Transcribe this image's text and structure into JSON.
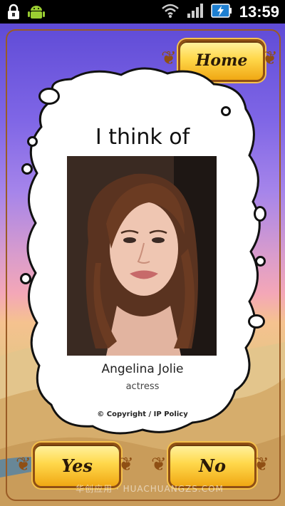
{
  "status_bar": {
    "time": "13:59",
    "icons": [
      "lock-icon",
      "android-icon",
      "wifi-icon",
      "signal-icon",
      "battery-charging-icon"
    ]
  },
  "header": {
    "home_label": "Home"
  },
  "card": {
    "title": "I think of",
    "person_name": "Angelina Jolie",
    "occupation": "actress",
    "copyright": "© Copyright / IP Policy"
  },
  "answers": {
    "yes_label": "Yes",
    "no_label": "No"
  },
  "watermark": "华创应用 · HUACHUANGZS.COM",
  "colors": {
    "button_gold": "#ffd84b",
    "frame": "#9a5b25",
    "sky_top": "#5f4bd6"
  }
}
